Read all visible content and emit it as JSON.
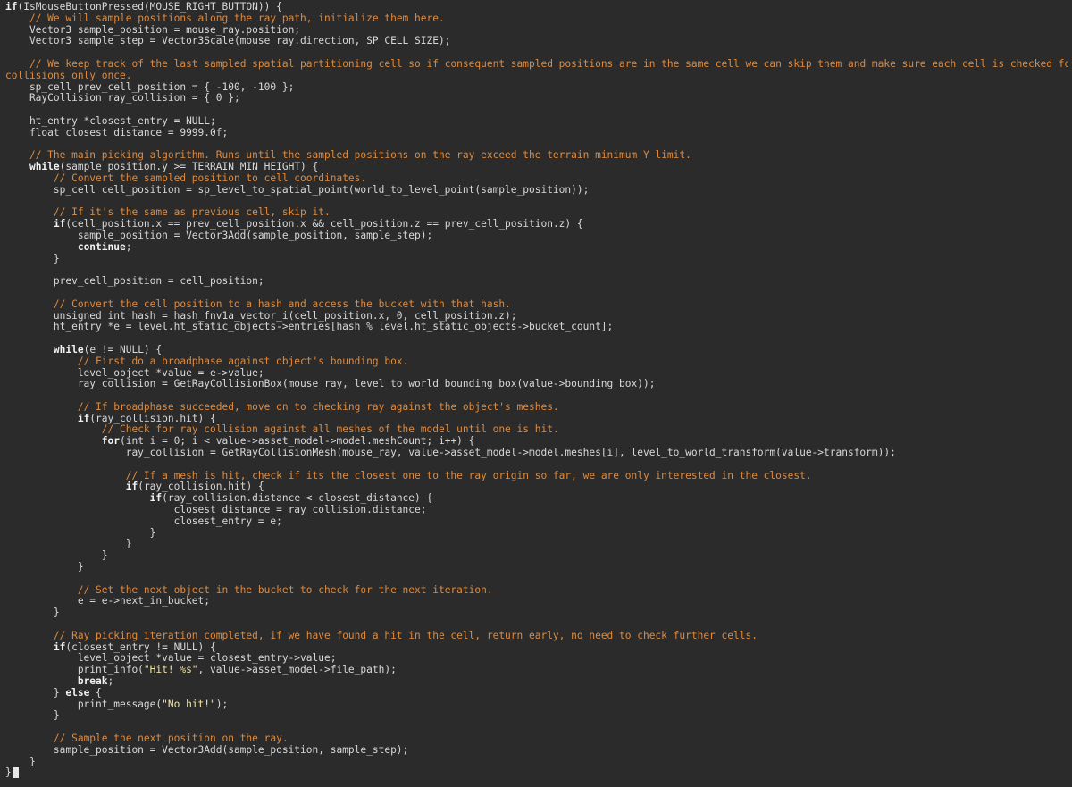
{
  "editor": {
    "background": "#2b2b2b",
    "colors": {
      "text": "#d8d8d8",
      "keyword": "#f3f3f3",
      "comment": "#e08a3c",
      "string": "#f3e6a0"
    },
    "lines": [
      [
        {
          "k": "kw",
          "t": "if"
        },
        {
          "k": "t",
          "t": "(IsMouseButtonPressed(MOUSE_RIGHT_BUTTON)) {"
        }
      ],
      [
        {
          "k": "t",
          "t": "    "
        },
        {
          "k": "cm",
          "t": "// We will sample positions along the ray path, initialize them here."
        }
      ],
      [
        {
          "k": "t",
          "t": "    Vector3 sample_position = mouse_ray.position;"
        }
      ],
      [
        {
          "k": "t",
          "t": "    Vector3 sample_step = Vector3Scale(mouse_ray.direction, SP_CELL_SIZE);"
        }
      ],
      [
        {
          "k": "t",
          "t": ""
        }
      ],
      [
        {
          "k": "t",
          "t": "    "
        },
        {
          "k": "cm",
          "t": "// We keep track of the last sampled spatial partitioning cell so if consequent sampled positions are in the same cell we can skip them and make sure each cell is checked for ray"
        }
      ],
      [
        {
          "k": "cm",
          "t": "collisions only once."
        }
      ],
      [
        {
          "k": "t",
          "t": "    sp_cell prev_cell_position = { -100, -100 };"
        }
      ],
      [
        {
          "k": "t",
          "t": "    RayCollision ray_collision = { 0 };"
        }
      ],
      [
        {
          "k": "t",
          "t": ""
        }
      ],
      [
        {
          "k": "t",
          "t": "    ht_entry *closest_entry = NULL;"
        }
      ],
      [
        {
          "k": "t",
          "t": "    float closest_distance = 9999.0f;"
        }
      ],
      [
        {
          "k": "t",
          "t": ""
        }
      ],
      [
        {
          "k": "t",
          "t": "    "
        },
        {
          "k": "cm",
          "t": "// The main picking algorithm. Runs until the sampled positions on the ray exceed the terrain minimum Y limit."
        }
      ],
      [
        {
          "k": "t",
          "t": "    "
        },
        {
          "k": "kw",
          "t": "while"
        },
        {
          "k": "t",
          "t": "(sample_position.y >= TERRAIN_MIN_HEIGHT) {"
        }
      ],
      [
        {
          "k": "t",
          "t": "        "
        },
        {
          "k": "cm",
          "t": "// Convert the sampled position to cell coordinates."
        }
      ],
      [
        {
          "k": "t",
          "t": "        sp_cell cell_position = sp_level_to_spatial_point(world_to_level_point(sample_position));"
        }
      ],
      [
        {
          "k": "t",
          "t": ""
        }
      ],
      [
        {
          "k": "t",
          "t": "        "
        },
        {
          "k": "cm",
          "t": "// If it's the same as previous cell, skip it."
        }
      ],
      [
        {
          "k": "t",
          "t": "        "
        },
        {
          "k": "kw",
          "t": "if"
        },
        {
          "k": "t",
          "t": "(cell_position.x == prev_cell_position.x && cell_position.z == prev_cell_position.z) {"
        }
      ],
      [
        {
          "k": "t",
          "t": "            sample_position = Vector3Add(sample_position, sample_step);"
        }
      ],
      [
        {
          "k": "t",
          "t": "            "
        },
        {
          "k": "kw",
          "t": "continue"
        },
        {
          "k": "t",
          "t": ";"
        }
      ],
      [
        {
          "k": "t",
          "t": "        }"
        }
      ],
      [
        {
          "k": "t",
          "t": ""
        }
      ],
      [
        {
          "k": "t",
          "t": "        prev_cell_position = cell_position;"
        }
      ],
      [
        {
          "k": "t",
          "t": ""
        }
      ],
      [
        {
          "k": "t",
          "t": "        "
        },
        {
          "k": "cm",
          "t": "// Convert the cell position to a hash and access the bucket with that hash."
        }
      ],
      [
        {
          "k": "t",
          "t": "        unsigned int hash = hash_fnv1a_vector_i(cell_position.x, 0, cell_position.z);"
        }
      ],
      [
        {
          "k": "t",
          "t": "        ht_entry *e = level.ht_static_objects->entries[hash % level.ht_static_objects->bucket_count];"
        }
      ],
      [
        {
          "k": "t",
          "t": ""
        }
      ],
      [
        {
          "k": "t",
          "t": "        "
        },
        {
          "k": "kw",
          "t": "while"
        },
        {
          "k": "t",
          "t": "(e != NULL) {"
        }
      ],
      [
        {
          "k": "t",
          "t": "            "
        },
        {
          "k": "cm",
          "t": "// First do a broadphase against object's bounding box."
        }
      ],
      [
        {
          "k": "t",
          "t": "            level_object *value = e->value;"
        }
      ],
      [
        {
          "k": "t",
          "t": "            ray_collision = GetRayCollisionBox(mouse_ray, level_to_world_bounding_box(value->bounding_box));"
        }
      ],
      [
        {
          "k": "t",
          "t": ""
        }
      ],
      [
        {
          "k": "t",
          "t": "            "
        },
        {
          "k": "cm",
          "t": "// If broadphase succeeded, move on to checking ray against the object's meshes."
        }
      ],
      [
        {
          "k": "t",
          "t": "            "
        },
        {
          "k": "kw",
          "t": "if"
        },
        {
          "k": "t",
          "t": "(ray_collision.hit) {"
        }
      ],
      [
        {
          "k": "t",
          "t": "                "
        },
        {
          "k": "cm",
          "t": "// Check for ray collision against all meshes of the model until one is hit."
        }
      ],
      [
        {
          "k": "t",
          "t": "                "
        },
        {
          "k": "kw",
          "t": "for"
        },
        {
          "k": "t",
          "t": "(int i = 0; i < value->asset_model->model.meshCount; i++) {"
        }
      ],
      [
        {
          "k": "t",
          "t": "                    ray_collision = GetRayCollisionMesh(mouse_ray, value->asset_model->model.meshes[i], level_to_world_transform(value->transform));"
        }
      ],
      [
        {
          "k": "t",
          "t": ""
        }
      ],
      [
        {
          "k": "t",
          "t": "                    "
        },
        {
          "k": "cm",
          "t": "// If a mesh is hit, check if its the closest one to the ray origin so far, we are only interested in the closest."
        }
      ],
      [
        {
          "k": "t",
          "t": "                    "
        },
        {
          "k": "kw",
          "t": "if"
        },
        {
          "k": "t",
          "t": "(ray_collision.hit) {"
        }
      ],
      [
        {
          "k": "t",
          "t": "                        "
        },
        {
          "k": "kw",
          "t": "if"
        },
        {
          "k": "t",
          "t": "(ray_collision.distance < closest_distance) {"
        }
      ],
      [
        {
          "k": "t",
          "t": "                            closest_distance = ray_collision.distance;"
        }
      ],
      [
        {
          "k": "t",
          "t": "                            closest_entry = e;"
        }
      ],
      [
        {
          "k": "t",
          "t": "                        }"
        }
      ],
      [
        {
          "k": "t",
          "t": "                    }"
        }
      ],
      [
        {
          "k": "t",
          "t": "                }"
        }
      ],
      [
        {
          "k": "t",
          "t": "            }"
        }
      ],
      [
        {
          "k": "t",
          "t": ""
        }
      ],
      [
        {
          "k": "t",
          "t": "            "
        },
        {
          "k": "cm",
          "t": "// Set the next object in the bucket to check for the next iteration."
        }
      ],
      [
        {
          "k": "t",
          "t": "            e = e->next_in_bucket;"
        }
      ],
      [
        {
          "k": "t",
          "t": "        }"
        }
      ],
      [
        {
          "k": "t",
          "t": ""
        }
      ],
      [
        {
          "k": "t",
          "t": "        "
        },
        {
          "k": "cm",
          "t": "// Ray picking iteration completed, if we have found a hit in the cell, return early, no need to check further cells."
        }
      ],
      [
        {
          "k": "t",
          "t": "        "
        },
        {
          "k": "kw",
          "t": "if"
        },
        {
          "k": "t",
          "t": "(closest_entry != NULL) {"
        }
      ],
      [
        {
          "k": "t",
          "t": "            level_object *value = closest_entry->value;"
        }
      ],
      [
        {
          "k": "t",
          "t": "            print_info("
        },
        {
          "k": "str",
          "t": "\"Hit! %s\""
        },
        {
          "k": "t",
          "t": ", value->asset_model->file_path);"
        }
      ],
      [
        {
          "k": "t",
          "t": "            "
        },
        {
          "k": "kw",
          "t": "break"
        },
        {
          "k": "t",
          "t": ";"
        }
      ],
      [
        {
          "k": "t",
          "t": "        } "
        },
        {
          "k": "kw",
          "t": "else"
        },
        {
          "k": "t",
          "t": " {"
        }
      ],
      [
        {
          "k": "t",
          "t": "            print_message("
        },
        {
          "k": "str",
          "t": "\"No hit!\""
        },
        {
          "k": "t",
          "t": ");"
        }
      ],
      [
        {
          "k": "t",
          "t": "        }"
        }
      ],
      [
        {
          "k": "t",
          "t": ""
        }
      ],
      [
        {
          "k": "t",
          "t": "        "
        },
        {
          "k": "cm",
          "t": "// Sample the next position on the ray."
        }
      ],
      [
        {
          "k": "t",
          "t": "        sample_position = Vector3Add(sample_position, sample_step);"
        }
      ],
      [
        {
          "k": "t",
          "t": "    }"
        }
      ],
      [
        {
          "k": "t",
          "t": "}"
        }
      ]
    ]
  }
}
